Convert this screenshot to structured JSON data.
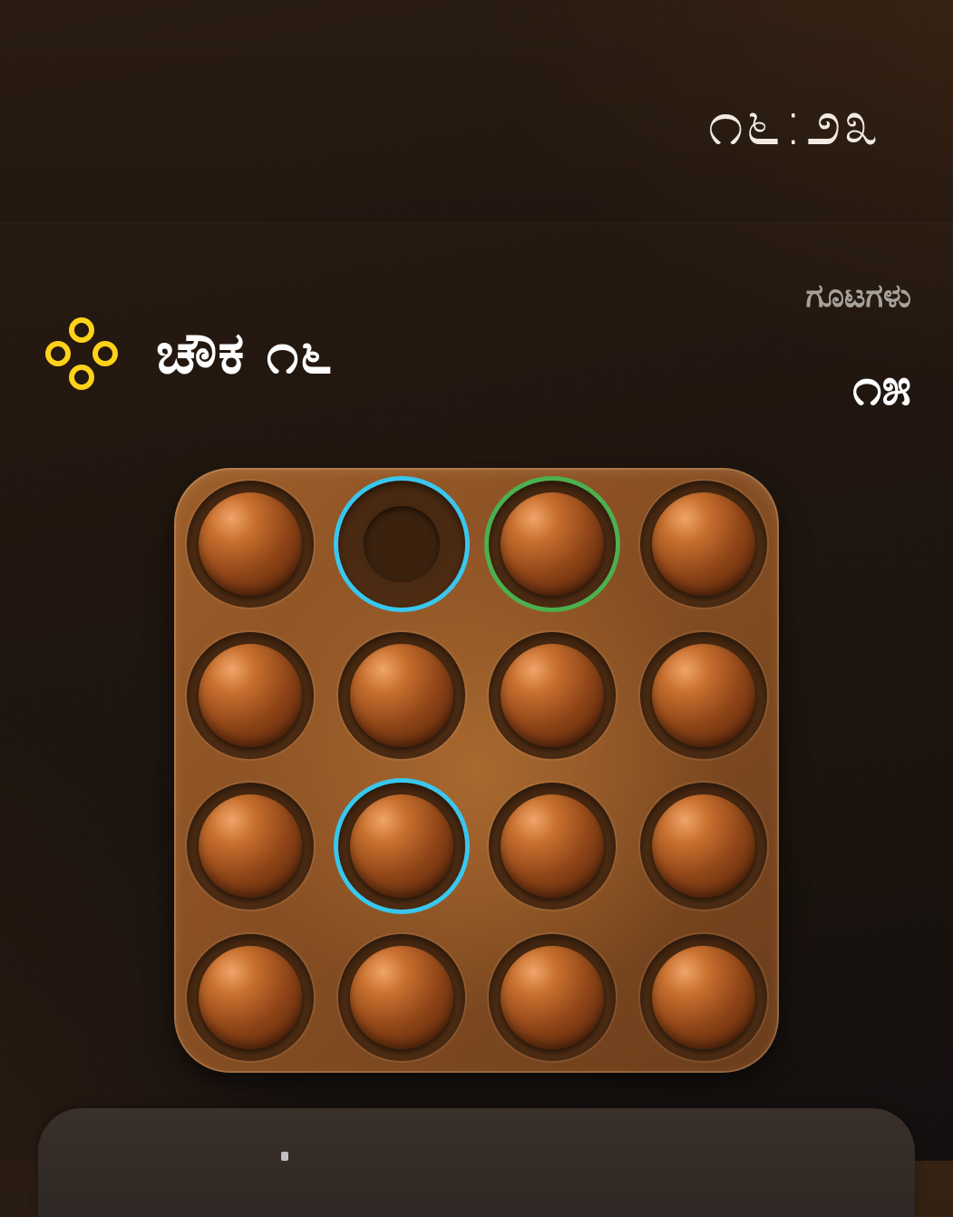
{
  "header": {
    "clock": "೧೬:೨೩"
  },
  "level": {
    "icon": "four-rings-icon",
    "icon_color": "#ffd21a",
    "label": "ಚೌಕ ೧೬"
  },
  "score": {
    "label": "ಗೂಟಗಳು",
    "value": "೧೫"
  },
  "board": {
    "rows": 4,
    "cols": 4,
    "cells": [
      [
        {
          "peg": true,
          "highlight": ""
        },
        {
          "peg": false,
          "highlight": "blue"
        },
        {
          "peg": true,
          "highlight": "green"
        },
        {
          "peg": true,
          "highlight": ""
        }
      ],
      [
        {
          "peg": true,
          "highlight": ""
        },
        {
          "peg": true,
          "highlight": ""
        },
        {
          "peg": true,
          "highlight": ""
        },
        {
          "peg": true,
          "highlight": ""
        }
      ],
      [
        {
          "peg": true,
          "highlight": ""
        },
        {
          "peg": true,
          "highlight": "blue"
        },
        {
          "peg": true,
          "highlight": ""
        },
        {
          "peg": true,
          "highlight": ""
        }
      ],
      [
        {
          "peg": true,
          "highlight": ""
        },
        {
          "peg": true,
          "highlight": ""
        },
        {
          "peg": true,
          "highlight": ""
        },
        {
          "peg": true,
          "highlight": ""
        }
      ]
    ]
  },
  "colors": {
    "highlight_blue": "#38c7ef",
    "highlight_green": "#4cb04f",
    "board_wood": "#8a5024"
  }
}
